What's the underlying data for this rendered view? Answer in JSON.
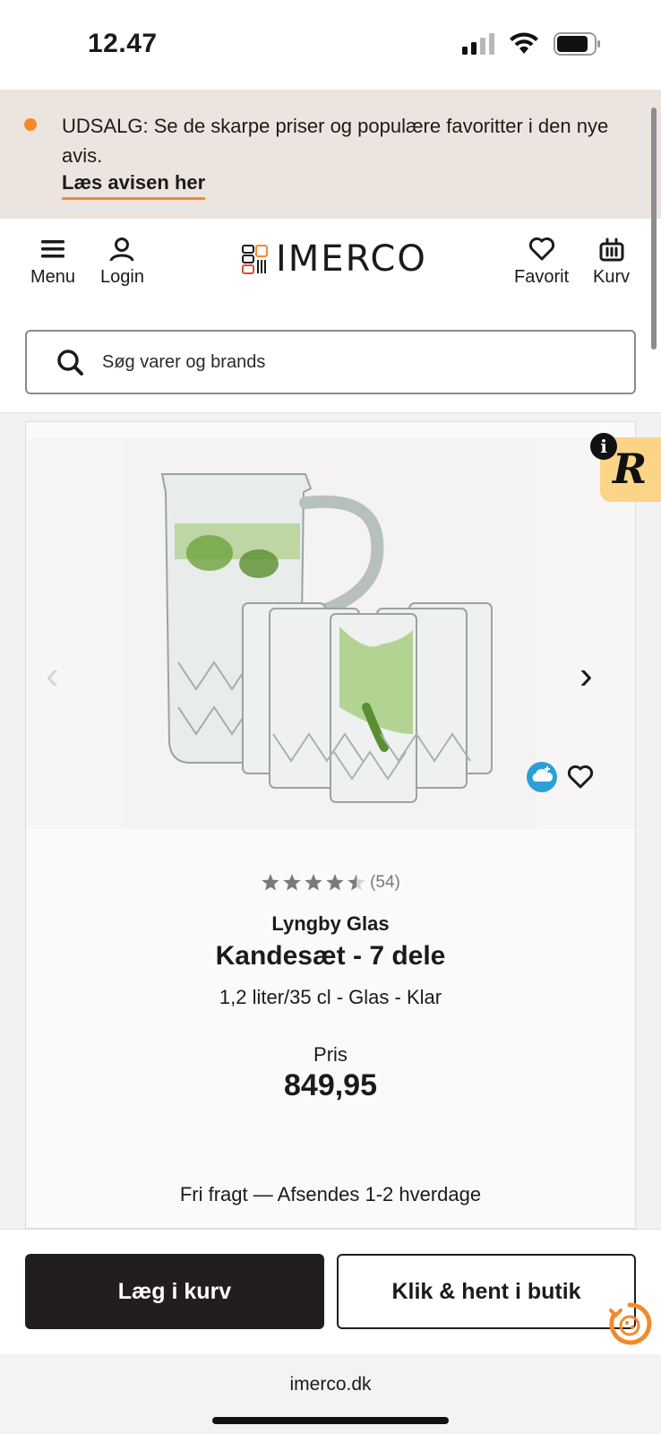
{
  "status_bar": {
    "time": "12.47"
  },
  "promo": {
    "text": "UDSALG: Se de skarpe priser og populære favoritter i den nye avis.",
    "link": "Læs avisen her",
    "accent": "#f38a2a"
  },
  "header": {
    "menu_label": "Menu",
    "login_label": "Login",
    "logo_text": "IMERCO",
    "favorite_label": "Favorit",
    "cart_label": "Kurv"
  },
  "search": {
    "placeholder": "Søg varer og brands"
  },
  "badge": {
    "letter": "R",
    "info": "i"
  },
  "product": {
    "rating_value": 4.5,
    "review_count": "(54)",
    "brand": "Lyngby Glas",
    "title": "Kandesæt - 7 dele",
    "subtitle": "1,2 liter/35 cl - Glas - Klar",
    "price_label": "Pris",
    "price": "849,95",
    "shipping": "Fri fragt — Afsendes 1-2 hverdage"
  },
  "actions": {
    "add_to_cart": "Læg i kurv",
    "click_collect": "Klik & hent i butik"
  },
  "browser": {
    "url": "imerco.dk"
  },
  "colors": {
    "dark": "#221e1f",
    "promo_bg": "#ece4de",
    "accent": "#f38a2a",
    "badge": "#fbd488",
    "cloud": "#2b9fd8"
  }
}
